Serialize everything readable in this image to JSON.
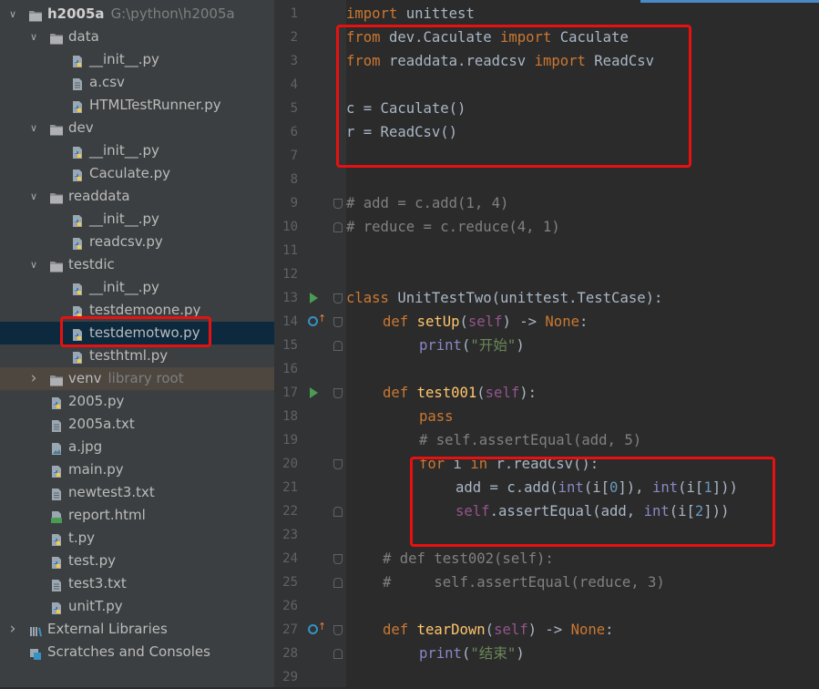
{
  "project": {
    "name": "h2005a",
    "path": "G:\\python\\h2005a"
  },
  "tree": [
    {
      "label": "h2005a",
      "extra": "G:\\python\\h2005a",
      "depth": 0,
      "type": "folder",
      "expanded": true,
      "bold": true
    },
    {
      "label": "data",
      "depth": 1,
      "type": "folder",
      "expanded": true
    },
    {
      "label": "__init__.py",
      "depth": 2,
      "type": "py"
    },
    {
      "label": "a.csv",
      "depth": 2,
      "type": "file"
    },
    {
      "label": "HTMLTestRunner.py",
      "depth": 2,
      "type": "py"
    },
    {
      "label": "dev",
      "depth": 1,
      "type": "folder",
      "expanded": true
    },
    {
      "label": "__init__.py",
      "depth": 2,
      "type": "py"
    },
    {
      "label": "Caculate.py",
      "depth": 2,
      "type": "py"
    },
    {
      "label": "readdata",
      "depth": 1,
      "type": "folder",
      "expanded": true
    },
    {
      "label": "__init__.py",
      "depth": 2,
      "type": "py"
    },
    {
      "label": "readcsv.py",
      "depth": 2,
      "type": "py"
    },
    {
      "label": "testdic",
      "depth": 1,
      "type": "folder",
      "expanded": true
    },
    {
      "label": "__init__.py",
      "depth": 2,
      "type": "py"
    },
    {
      "label": "testdemoone.py",
      "depth": 2,
      "type": "py"
    },
    {
      "label": "testdemotwo.py",
      "depth": 2,
      "type": "py",
      "selected": true
    },
    {
      "label": "testhtml.py",
      "depth": 2,
      "type": "py"
    },
    {
      "label": "venv",
      "extra": "library root",
      "depth": 1,
      "type": "folder",
      "expanded": false,
      "venv": true
    },
    {
      "label": "2005.py",
      "depth": 1,
      "type": "py"
    },
    {
      "label": "2005a.txt",
      "depth": 1,
      "type": "file"
    },
    {
      "label": "a.jpg",
      "depth": 1,
      "type": "image"
    },
    {
      "label": "main.py",
      "depth": 1,
      "type": "py"
    },
    {
      "label": "newtest3.txt",
      "depth": 1,
      "type": "file"
    },
    {
      "label": "report.html",
      "depth": 1,
      "type": "html"
    },
    {
      "label": "t.py",
      "depth": 1,
      "type": "py"
    },
    {
      "label": "test.py",
      "depth": 1,
      "type": "py"
    },
    {
      "label": "test3.txt",
      "depth": 1,
      "type": "file"
    },
    {
      "label": "unitT.py",
      "depth": 1,
      "type": "py"
    },
    {
      "label": "External Libraries",
      "depth": 0,
      "type": "library",
      "expanded": false
    },
    {
      "label": "Scratches and Consoles",
      "depth": 0,
      "type": "scratch"
    }
  ],
  "code": [
    {
      "n": "1",
      "indent": 0,
      "tokens": [
        [
          "kw",
          "import"
        ],
        [
          "p",
          " unittest"
        ]
      ]
    },
    {
      "n": "2",
      "indent": 0,
      "tokens": [
        [
          "kw",
          "from"
        ],
        [
          "p",
          " dev.Caculate "
        ],
        [
          "kw",
          "import"
        ],
        [
          "p",
          " Caculate"
        ]
      ]
    },
    {
      "n": "3",
      "indent": 0,
      "tokens": [
        [
          "kw",
          "from"
        ],
        [
          "p",
          " readdata.readcsv "
        ],
        [
          "kw",
          "import"
        ],
        [
          "p",
          " ReadCsv"
        ]
      ]
    },
    {
      "n": "4",
      "indent": 0,
      "tokens": []
    },
    {
      "n": "5",
      "indent": 0,
      "tokens": [
        [
          "p",
          "c = Caculate()"
        ]
      ]
    },
    {
      "n": "6",
      "indent": 0,
      "tokens": [
        [
          "p",
          "r = ReadCsv()"
        ]
      ]
    },
    {
      "n": "7",
      "indent": 0,
      "tokens": []
    },
    {
      "n": "8",
      "indent": 0,
      "tokens": []
    },
    {
      "n": "9",
      "indent": 0,
      "tokens": [
        [
          "cm",
          "# add = c.add(1, 4)"
        ]
      ],
      "fold": "open"
    },
    {
      "n": "10",
      "indent": 0,
      "tokens": [
        [
          "cm",
          "# reduce = c.reduce(4, 1)"
        ]
      ],
      "fold": "close"
    },
    {
      "n": "11",
      "indent": 0,
      "tokens": []
    },
    {
      "n": "12",
      "indent": 0,
      "tokens": []
    },
    {
      "n": "13",
      "indent": 0,
      "tokens": [
        [
          "kw",
          "class"
        ],
        [
          "p",
          " "
        ],
        [
          "cls",
          "UnitTestTwo"
        ],
        [
          "p",
          "(unittest.TestCase):"
        ]
      ],
      "marker": "run",
      "fold": "open"
    },
    {
      "n": "14",
      "indent": 1,
      "tokens": [
        [
          "kw",
          "def"
        ],
        [
          "p",
          " "
        ],
        [
          "fn",
          "setUp"
        ],
        [
          "p",
          "("
        ],
        [
          "slf",
          "self"
        ],
        [
          "p",
          ") -> "
        ],
        [
          "kw",
          "None"
        ],
        [
          "p",
          ":"
        ]
      ],
      "marker": "override",
      "fold": "open"
    },
    {
      "n": "15",
      "indent": 2,
      "tokens": [
        [
          "bi",
          "print"
        ],
        [
          "p",
          "("
        ],
        [
          "str",
          "\"开始\""
        ],
        [
          "p",
          ")"
        ]
      ],
      "fold": "close"
    },
    {
      "n": "16",
      "indent": 0,
      "tokens": []
    },
    {
      "n": "17",
      "indent": 1,
      "tokens": [
        [
          "kw",
          "def"
        ],
        [
          "p",
          " "
        ],
        [
          "fn",
          "test001"
        ],
        [
          "p",
          "("
        ],
        [
          "slf",
          "self"
        ],
        [
          "p",
          "):"
        ]
      ],
      "marker": "run",
      "fold": "open"
    },
    {
      "n": "18",
      "indent": 2,
      "tokens": [
        [
          "kw",
          "pass"
        ]
      ]
    },
    {
      "n": "19",
      "indent": 2,
      "tokens": [
        [
          "cm",
          "# self.assertEqual(add, 5)"
        ]
      ]
    },
    {
      "n": "20",
      "indent": 2,
      "tokens": [
        [
          "kw",
          "for"
        ],
        [
          "p",
          " i "
        ],
        [
          "kw",
          "in"
        ],
        [
          "p",
          " r.readCsv():"
        ]
      ],
      "fold": "open"
    },
    {
      "n": "21",
      "indent": 3,
      "tokens": [
        [
          "p",
          "add = c.add("
        ],
        [
          "bi",
          "int"
        ],
        [
          "p",
          "(i["
        ],
        [
          "num",
          "0"
        ],
        [
          "p",
          "]), "
        ],
        [
          "bi",
          "int"
        ],
        [
          "p",
          "(i["
        ],
        [
          "num",
          "1"
        ],
        [
          "p",
          "]))"
        ]
      ]
    },
    {
      "n": "22",
      "indent": 3,
      "tokens": [
        [
          "slf",
          "self"
        ],
        [
          "p",
          ".assertEqual(add, "
        ],
        [
          "bi",
          "int"
        ],
        [
          "p",
          "(i["
        ],
        [
          "num",
          "2"
        ],
        [
          "p",
          "]))"
        ]
      ],
      "fold": "close"
    },
    {
      "n": "23",
      "indent": 0,
      "tokens": []
    },
    {
      "n": "24",
      "indent": 1,
      "tokens": [
        [
          "cm",
          "# def test002(self):"
        ]
      ],
      "fold": "open"
    },
    {
      "n": "25",
      "indent": 1,
      "tokens": [
        [
          "cm",
          "#     self.assertEqual(reduce, 3)"
        ]
      ],
      "fold": "close"
    },
    {
      "n": "26",
      "indent": 0,
      "tokens": []
    },
    {
      "n": "27",
      "indent": 1,
      "tokens": [
        [
          "kw",
          "def"
        ],
        [
          "p",
          " "
        ],
        [
          "fn",
          "tearDown"
        ],
        [
          "p",
          "("
        ],
        [
          "slf",
          "self"
        ],
        [
          "p",
          ") -> "
        ],
        [
          "kw",
          "None"
        ],
        [
          "p",
          ":"
        ]
      ],
      "marker": "override",
      "fold": "open"
    },
    {
      "n": "28",
      "indent": 2,
      "tokens": [
        [
          "bi",
          "print"
        ],
        [
          "p",
          "("
        ],
        [
          "str",
          "\"结束\""
        ],
        [
          "p",
          ")"
        ]
      ],
      "fold": "close"
    },
    {
      "n": "29",
      "indent": 0,
      "tokens": []
    }
  ],
  "colors": {
    "highlight_box": "#e81010",
    "selected_row": "#0d293e",
    "venv_row": "#4d4740",
    "keyword": "#cc7832",
    "function": "#ffc66d",
    "string": "#6a8759",
    "number": "#6897bb",
    "comment": "#808080",
    "self": "#94558d",
    "builtin": "#8888c6"
  }
}
